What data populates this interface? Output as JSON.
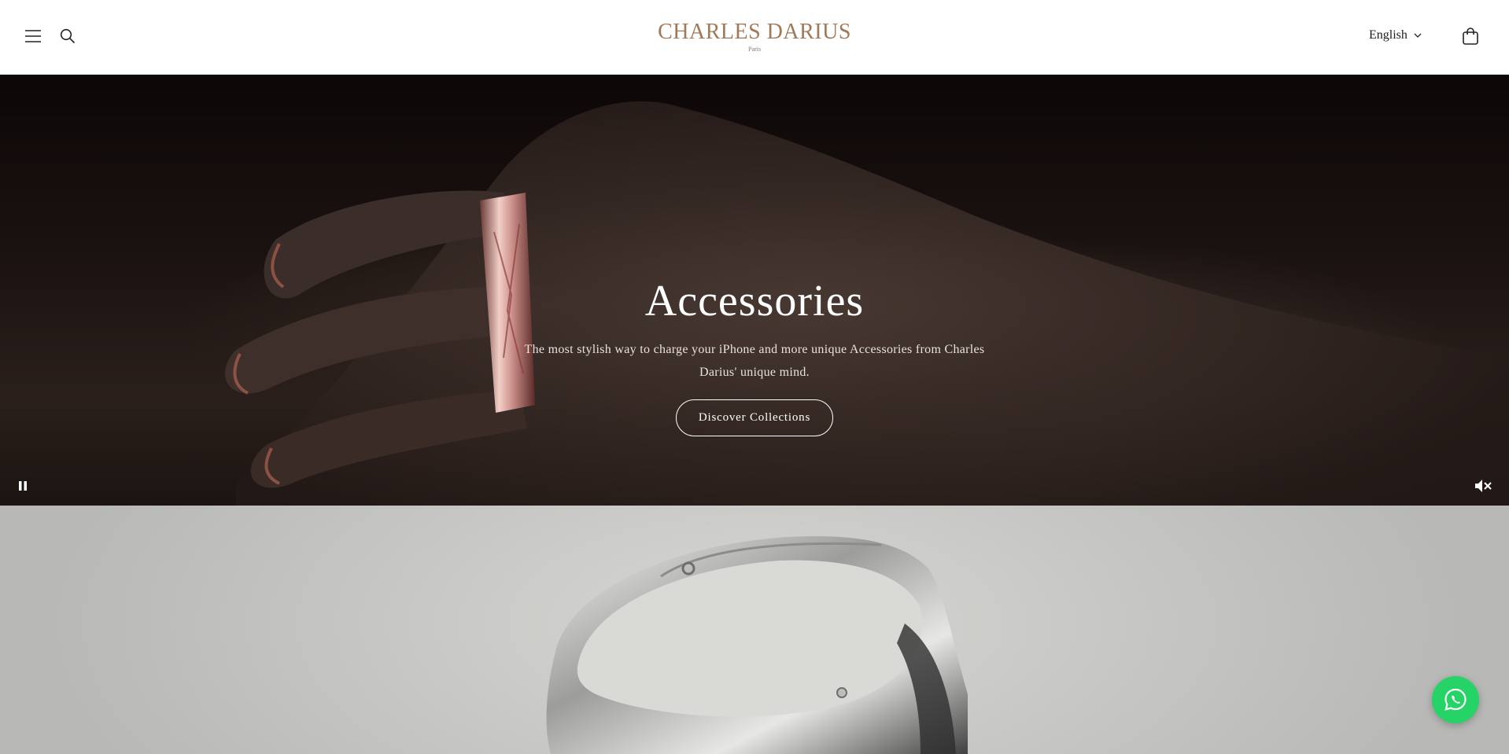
{
  "header": {
    "brand": "CHARLES DARIUS",
    "brand_sub": "Paris",
    "language": "English",
    "icons": {
      "menu": "hamburger-menu-icon",
      "search": "search-icon",
      "cart": "shopping-bag-icon",
      "language_chevron": "chevron-down-icon"
    },
    "brand_color": "#a07a58"
  },
  "hero": {
    "title": "Accessories",
    "text": "The most stylish way to charge your iPhone and more unique Accessories from Charles Darius' unique mind.",
    "cta": "Discover Collections",
    "controls": {
      "pause": "pause-icon",
      "mute": "volume-muted-icon"
    }
  },
  "floating": {
    "whatsapp": "whatsapp-icon",
    "whatsapp_color": "#25d366"
  }
}
